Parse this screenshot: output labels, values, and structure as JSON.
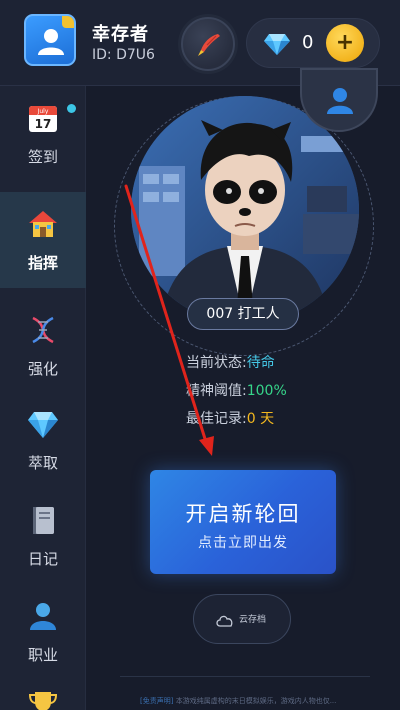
{
  "header": {
    "user_name": "幸存者",
    "user_id": "ID: D7U6",
    "gem_count": "0",
    "plus_label": "+"
  },
  "sidebar": {
    "items": [
      {
        "label": "签到",
        "icon": "calendar-icon",
        "calendar_month": "July",
        "calendar_day": "17",
        "badge_dot": true
      },
      {
        "label": "指挥",
        "icon": "house-icon",
        "active": true
      },
      {
        "label": "强化",
        "icon": "dna-icon"
      },
      {
        "label": "萃取",
        "icon": "diamond-icon"
      },
      {
        "label": "日记",
        "icon": "book-icon"
      },
      {
        "label": "职业",
        "icon": "person-icon"
      },
      {
        "label": "",
        "icon": "trophy-icon"
      }
    ]
  },
  "character": {
    "name": "007 打工人",
    "stats": [
      {
        "label": "当前状态:",
        "value": "待命",
        "color": "#45c7e6"
      },
      {
        "label": "精神阈值:",
        "value": "100%",
        "color": "#36d58a"
      },
      {
        "label": "最佳记录:",
        "value": "0 天",
        "color": "#f3b81f"
      }
    ]
  },
  "actions": {
    "start_title": "开启新轮回",
    "start_subtitle": "点击立即出发",
    "cloud_label": "云存档"
  },
  "footer": {
    "tag": "[免责声明]",
    "text": "本游戏纯属虚构的末日模拟娱乐，游戏内人物也仅..."
  },
  "colors": {
    "background": "#171c2b",
    "accent_blue": "#2f86e5",
    "annotation_arrow": "#e0241c"
  }
}
